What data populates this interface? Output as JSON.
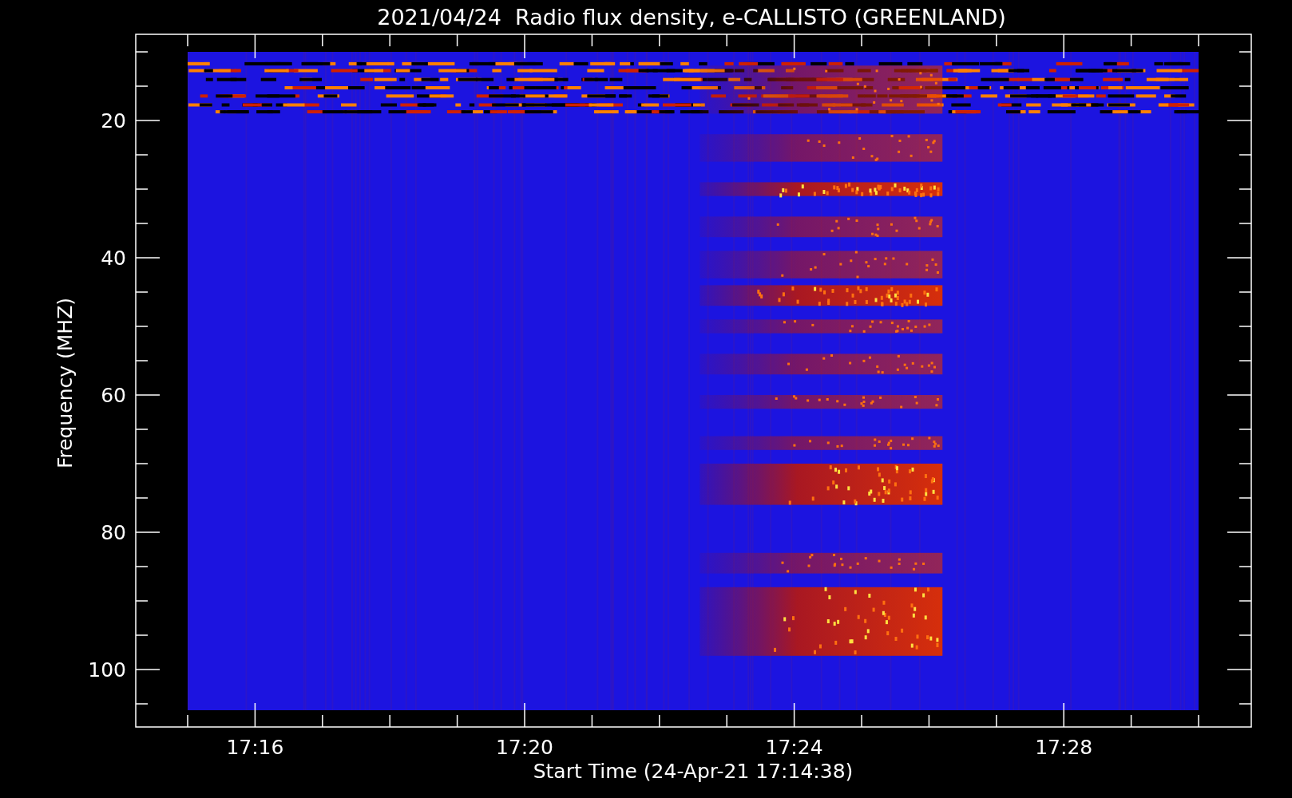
{
  "title": "2021/04/24  Radio flux density, e-CALLISTO (GREENLAND)",
  "y_axis": {
    "label": "Frequency (MHZ)",
    "ticks": [
      "20",
      "40",
      "60",
      "80",
      "100"
    ]
  },
  "x_axis": {
    "label": "Start Time (24-Apr-21 17:14:38)",
    "ticks": [
      "17:16",
      "17:20",
      "17:24",
      "17:28"
    ]
  }
}
